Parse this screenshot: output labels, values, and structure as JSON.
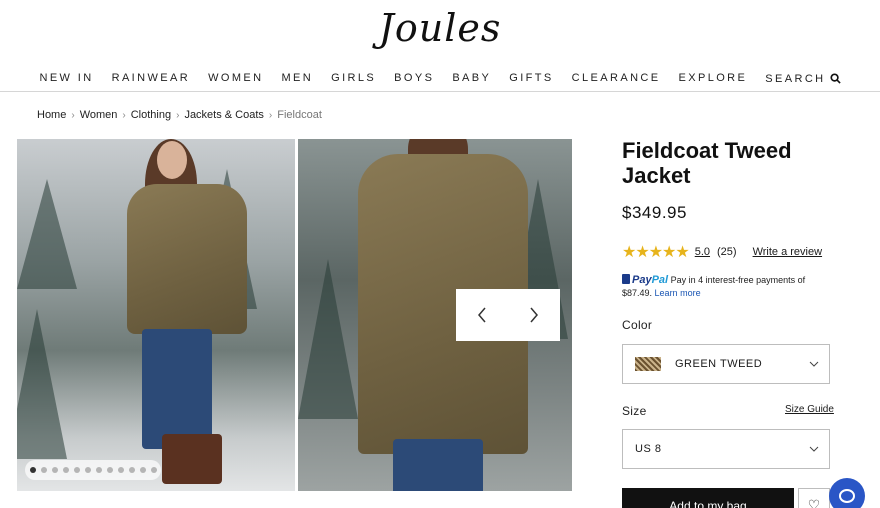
{
  "brand": {
    "logo_text": "Joules"
  },
  "nav": {
    "items": [
      "NEW IN",
      "RAINWEAR",
      "WOMEN",
      "MEN",
      "GIRLS",
      "BOYS",
      "BABY",
      "GIFTS",
      "CLEARANCE",
      "EXPLORE"
    ],
    "search_label": "SEARCH"
  },
  "breadcrumb": [
    "Home",
    "Women",
    "Clothing",
    "Jackets & Coats",
    "Fieldcoat"
  ],
  "gallery": {
    "slide_count": 12,
    "active_index": 0,
    "icons": {
      "prev": "chevron-left-icon",
      "next": "chevron-right-icon"
    }
  },
  "product": {
    "title": "Fieldcoat Tweed Jacket",
    "price": "$349.95",
    "rating": {
      "stars": 5,
      "value": "5.0",
      "count": "(25)",
      "write_review": "Write a review"
    },
    "paypal": {
      "logo_pay": "Pay",
      "logo_pal": "Pal",
      "text": "Pay in 4 interest-free payments of $87.49.",
      "learn_more": "Learn more"
    },
    "color_label": "Color",
    "color_value": "GREEN TWEED",
    "size_label": "Size",
    "size_guide": "Size Guide",
    "size_value": "US 8",
    "add_to_bag": "Add to my bag"
  },
  "colors": {
    "paypal_dark": "#1b3b8a",
    "paypal_light": "#1f9ad6",
    "star": "#e7b41c",
    "chat": "#2a56c6"
  }
}
